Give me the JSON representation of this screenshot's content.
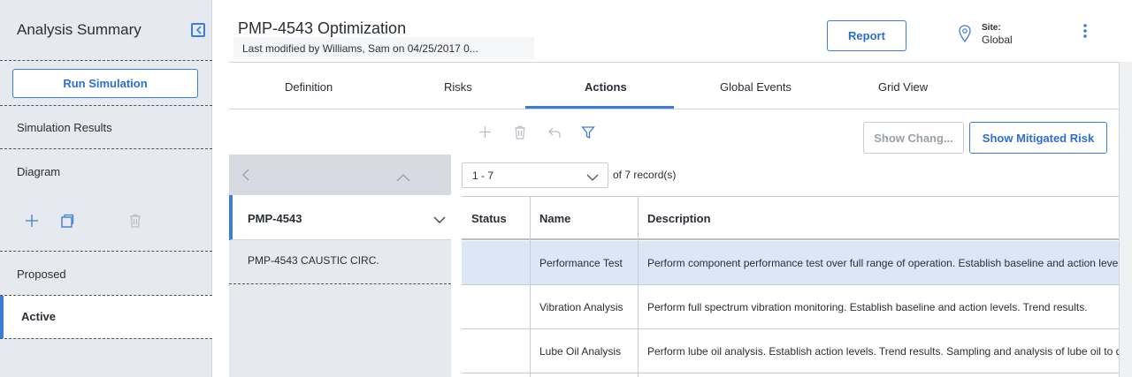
{
  "sidebar": {
    "title": "Analysis Summary",
    "run_simulation": "Run Simulation",
    "simulation_results": "Simulation Results",
    "diagram": "Diagram",
    "proposed": "Proposed",
    "active": "Active"
  },
  "header": {
    "title": "PMP-4543 Optimization",
    "last_modified": "Last modified by Williams, Sam on 04/25/2017 0...",
    "report_label": "Report",
    "site_label": "Site:",
    "site_value": "Global"
  },
  "tabs": [
    {
      "label": "Definition"
    },
    {
      "label": "Risks"
    },
    {
      "label": "Actions"
    },
    {
      "label": "Global Events"
    },
    {
      "label": "Grid View"
    }
  ],
  "toolbar": {
    "show_changes": "Show Chang...",
    "show_mitigated_risk": "Show Mitigated Risk"
  },
  "mid_panel": {
    "selected": "PMP-4543",
    "item": "PMP-4543 CAUSTIC CIRC."
  },
  "pager": {
    "range": "1 - 7",
    "of_label": "of",
    "total": "7",
    "records_label": "record(s)"
  },
  "table": {
    "columns": [
      "Status",
      "Name",
      "Description"
    ],
    "rows": [
      {
        "status": "",
        "name": "Performance Test",
        "description": "Perform component performance test over full range of operation. Establish baseline and action levels. Trend results."
      },
      {
        "status": "",
        "name": "Vibration Analysis",
        "description": "Perform full spectrum vibration monitoring. Establish baseline and action levels. Trend results."
      },
      {
        "status": "",
        "name": "Lube Oil Analysis",
        "description": "Perform lube oil analysis. Establish action levels. Trend results. Sampling and analysis of lube oil to detect wear."
      }
    ]
  },
  "colors": {
    "accent": "#3b7dd8",
    "sidebar_bg": "#e6e9ee",
    "selected_row": "#dbe7f7"
  }
}
